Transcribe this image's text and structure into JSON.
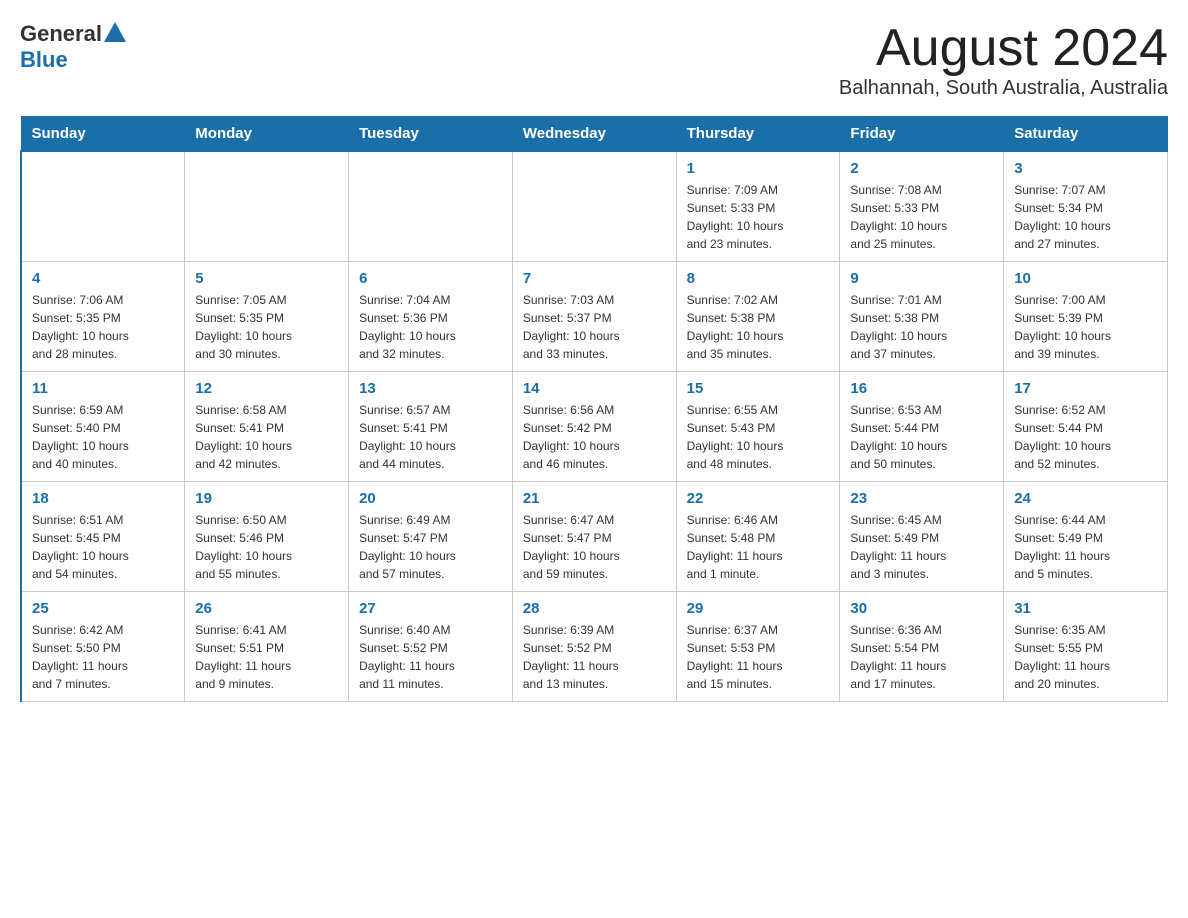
{
  "header": {
    "logo_general": "General",
    "logo_blue": "Blue",
    "title": "August 2024",
    "subtitle": "Balhannah, South Australia, Australia"
  },
  "weekdays": [
    "Sunday",
    "Monday",
    "Tuesday",
    "Wednesday",
    "Thursday",
    "Friday",
    "Saturday"
  ],
  "weeks": [
    [
      {
        "day": "",
        "info": ""
      },
      {
        "day": "",
        "info": ""
      },
      {
        "day": "",
        "info": ""
      },
      {
        "day": "",
        "info": ""
      },
      {
        "day": "1",
        "info": "Sunrise: 7:09 AM\nSunset: 5:33 PM\nDaylight: 10 hours\nand 23 minutes."
      },
      {
        "day": "2",
        "info": "Sunrise: 7:08 AM\nSunset: 5:33 PM\nDaylight: 10 hours\nand 25 minutes."
      },
      {
        "day": "3",
        "info": "Sunrise: 7:07 AM\nSunset: 5:34 PM\nDaylight: 10 hours\nand 27 minutes."
      }
    ],
    [
      {
        "day": "4",
        "info": "Sunrise: 7:06 AM\nSunset: 5:35 PM\nDaylight: 10 hours\nand 28 minutes."
      },
      {
        "day": "5",
        "info": "Sunrise: 7:05 AM\nSunset: 5:35 PM\nDaylight: 10 hours\nand 30 minutes."
      },
      {
        "day": "6",
        "info": "Sunrise: 7:04 AM\nSunset: 5:36 PM\nDaylight: 10 hours\nand 32 minutes."
      },
      {
        "day": "7",
        "info": "Sunrise: 7:03 AM\nSunset: 5:37 PM\nDaylight: 10 hours\nand 33 minutes."
      },
      {
        "day": "8",
        "info": "Sunrise: 7:02 AM\nSunset: 5:38 PM\nDaylight: 10 hours\nand 35 minutes."
      },
      {
        "day": "9",
        "info": "Sunrise: 7:01 AM\nSunset: 5:38 PM\nDaylight: 10 hours\nand 37 minutes."
      },
      {
        "day": "10",
        "info": "Sunrise: 7:00 AM\nSunset: 5:39 PM\nDaylight: 10 hours\nand 39 minutes."
      }
    ],
    [
      {
        "day": "11",
        "info": "Sunrise: 6:59 AM\nSunset: 5:40 PM\nDaylight: 10 hours\nand 40 minutes."
      },
      {
        "day": "12",
        "info": "Sunrise: 6:58 AM\nSunset: 5:41 PM\nDaylight: 10 hours\nand 42 minutes."
      },
      {
        "day": "13",
        "info": "Sunrise: 6:57 AM\nSunset: 5:41 PM\nDaylight: 10 hours\nand 44 minutes."
      },
      {
        "day": "14",
        "info": "Sunrise: 6:56 AM\nSunset: 5:42 PM\nDaylight: 10 hours\nand 46 minutes."
      },
      {
        "day": "15",
        "info": "Sunrise: 6:55 AM\nSunset: 5:43 PM\nDaylight: 10 hours\nand 48 minutes."
      },
      {
        "day": "16",
        "info": "Sunrise: 6:53 AM\nSunset: 5:44 PM\nDaylight: 10 hours\nand 50 minutes."
      },
      {
        "day": "17",
        "info": "Sunrise: 6:52 AM\nSunset: 5:44 PM\nDaylight: 10 hours\nand 52 minutes."
      }
    ],
    [
      {
        "day": "18",
        "info": "Sunrise: 6:51 AM\nSunset: 5:45 PM\nDaylight: 10 hours\nand 54 minutes."
      },
      {
        "day": "19",
        "info": "Sunrise: 6:50 AM\nSunset: 5:46 PM\nDaylight: 10 hours\nand 55 minutes."
      },
      {
        "day": "20",
        "info": "Sunrise: 6:49 AM\nSunset: 5:47 PM\nDaylight: 10 hours\nand 57 minutes."
      },
      {
        "day": "21",
        "info": "Sunrise: 6:47 AM\nSunset: 5:47 PM\nDaylight: 10 hours\nand 59 minutes."
      },
      {
        "day": "22",
        "info": "Sunrise: 6:46 AM\nSunset: 5:48 PM\nDaylight: 11 hours\nand 1 minute."
      },
      {
        "day": "23",
        "info": "Sunrise: 6:45 AM\nSunset: 5:49 PM\nDaylight: 11 hours\nand 3 minutes."
      },
      {
        "day": "24",
        "info": "Sunrise: 6:44 AM\nSunset: 5:49 PM\nDaylight: 11 hours\nand 5 minutes."
      }
    ],
    [
      {
        "day": "25",
        "info": "Sunrise: 6:42 AM\nSunset: 5:50 PM\nDaylight: 11 hours\nand 7 minutes."
      },
      {
        "day": "26",
        "info": "Sunrise: 6:41 AM\nSunset: 5:51 PM\nDaylight: 11 hours\nand 9 minutes."
      },
      {
        "day": "27",
        "info": "Sunrise: 6:40 AM\nSunset: 5:52 PM\nDaylight: 11 hours\nand 11 minutes."
      },
      {
        "day": "28",
        "info": "Sunrise: 6:39 AM\nSunset: 5:52 PM\nDaylight: 11 hours\nand 13 minutes."
      },
      {
        "day": "29",
        "info": "Sunrise: 6:37 AM\nSunset: 5:53 PM\nDaylight: 11 hours\nand 15 minutes."
      },
      {
        "day": "30",
        "info": "Sunrise: 6:36 AM\nSunset: 5:54 PM\nDaylight: 11 hours\nand 17 minutes."
      },
      {
        "day": "31",
        "info": "Sunrise: 6:35 AM\nSunset: 5:55 PM\nDaylight: 11 hours\nand 20 minutes."
      }
    ]
  ]
}
